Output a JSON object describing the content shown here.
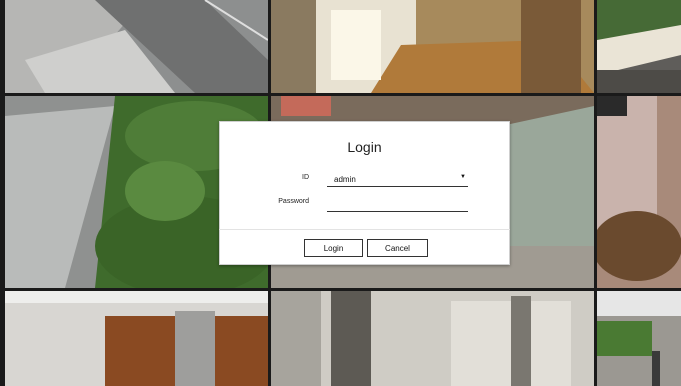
{
  "dialog": {
    "title": "Login",
    "id_label": "ID",
    "id_value": "admin",
    "password_label": "Password",
    "password_value": "",
    "login_button": "Login",
    "cancel_button": "Cancel"
  },
  "colors": {
    "dialog_bg": "#ffffff",
    "field_line": "#333333",
    "button_border": "#333333"
  },
  "icons": {
    "dropdown": "dropdown-caret-icon"
  }
}
